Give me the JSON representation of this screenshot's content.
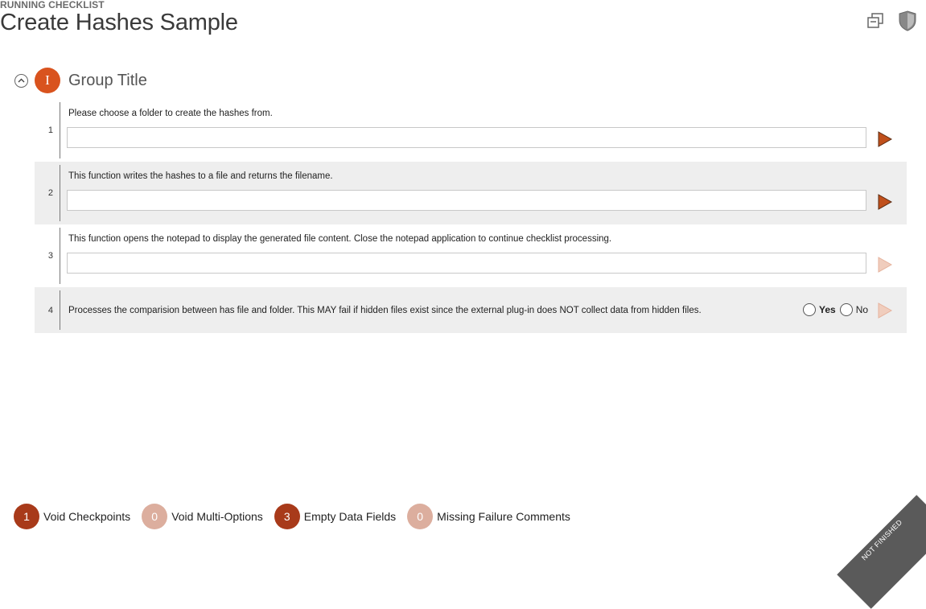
{
  "header": {
    "label": "RUNNING CHECKLIST",
    "title": "Create Hashes Sample",
    "icons": [
      "restore-windows-icon",
      "shield-icon"
    ]
  },
  "group": {
    "badge": "I",
    "title": "Group Title",
    "badge_color": "#d9531e"
  },
  "rows": [
    {
      "number": "1",
      "text": "Please choose a folder to create the hashes from.",
      "input_value": "",
      "play_enabled": true
    },
    {
      "number": "2",
      "text": "This function writes the hashes to a file and returns the filename.",
      "input_value": "",
      "play_enabled": true
    },
    {
      "number": "3",
      "text": "This function opens the notepad to display the generated file content. Close the notepad application to continue checklist processing.",
      "input_value": "",
      "play_enabled": false
    },
    {
      "number": "4",
      "text": "Processes the comparision between has file and folder. This MAY fail if hidden files exist since the external plug-in does NOT collect data from hidden files.",
      "yes_label": "Yes",
      "no_label": "No",
      "play_enabled": false
    }
  ],
  "footer": [
    {
      "count": "1",
      "label": "Void Checkpoints",
      "color": "#a83a1a"
    },
    {
      "count": "0",
      "label": "Void Multi-Options",
      "color": "#dcae9e"
    },
    {
      "count": "3",
      "label": "Empty Data Fields",
      "color": "#a83a1a"
    },
    {
      "count": "0",
      "label": "Missing Failure Comments",
      "color": "#dcae9e"
    }
  ],
  "corner_label": "NOT FINISHED",
  "colors": {
    "play_active": "#c0501c",
    "play_inactive": "#e9b8a4"
  }
}
